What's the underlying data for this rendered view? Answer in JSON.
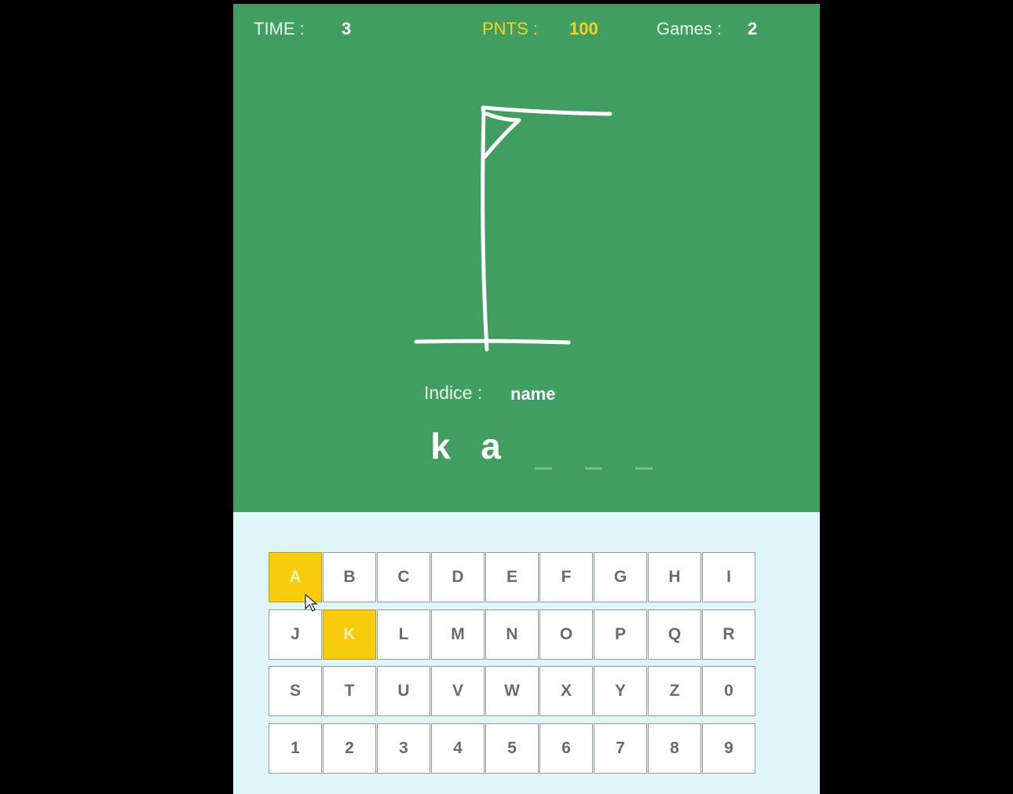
{
  "stats": {
    "time_label": "TIME :",
    "time_value": "3",
    "points_label": "PNTS :",
    "points_value": "100",
    "games_label": "Games :",
    "games_value": "2"
  },
  "hint": {
    "label": "Indice :",
    "value": "name"
  },
  "word": {
    "revealed": [
      "k",
      "a",
      "",
      "",
      ""
    ]
  },
  "keyboard": {
    "keys": [
      "A",
      "B",
      "C",
      "D",
      "E",
      "F",
      "G",
      "H",
      "I",
      "J",
      "K",
      "L",
      "M",
      "N",
      "O",
      "P",
      "Q",
      "R",
      "S",
      "T",
      "U",
      "V",
      "W",
      "X",
      "Y",
      "Z",
      "0",
      "1",
      "2",
      "3",
      "4",
      "5",
      "6",
      "7",
      "8",
      "9"
    ],
    "used": [
      "A",
      "K"
    ]
  },
  "colors": {
    "stage": "#3f9e60",
    "keyboard_area": "#dff6f8",
    "used_key": "#f7cc0a",
    "points_text": "#f1d51c"
  },
  "icons": {
    "gallows": "hangman-gallows-drawing",
    "cursor": "mouse-pointer-icon"
  }
}
